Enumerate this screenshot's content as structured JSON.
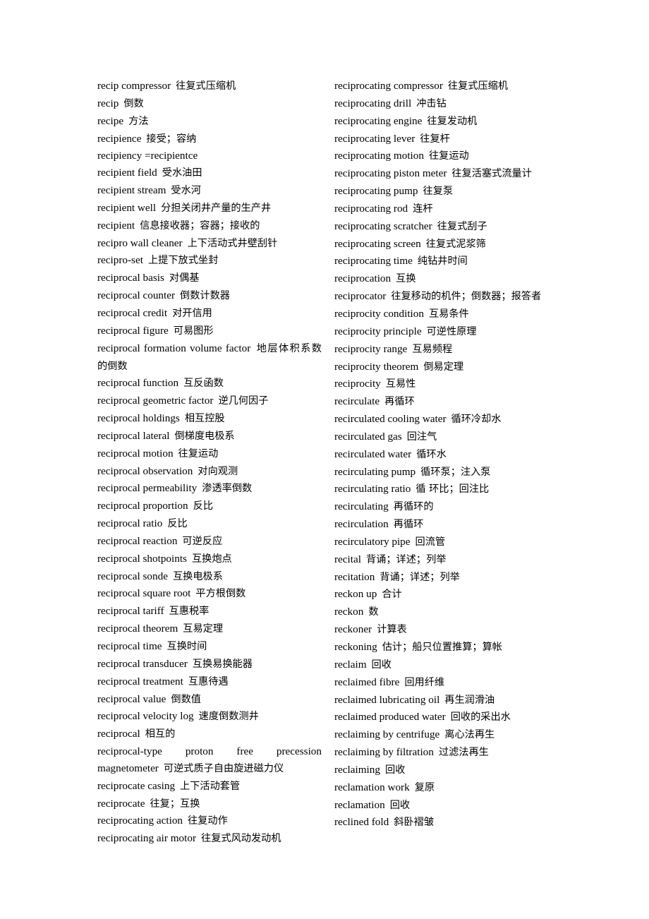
{
  "document": {
    "type": "bilingual-glossary-page",
    "language_pair": "English-Chinese",
    "background_color": "#ffffff",
    "text_color": "#000000"
  },
  "columns": [
    {
      "id": "left-column",
      "entries": [
        {
          "en": "recip compressor",
          "zh": "往复式压缩机"
        },
        {
          "en": "recip",
          "zh": "倒数"
        },
        {
          "en": "recipe",
          "zh": "方法"
        },
        {
          "en": "recipience",
          "zh": "接受；容纳"
        },
        {
          "en": "recipiency =recipientce",
          "zh": ""
        },
        {
          "en": "recipient field",
          "zh": "受水油田"
        },
        {
          "en": "recipient stream",
          "zh": "受水河"
        },
        {
          "en": "recipient well",
          "zh": "分担关闭井产量的生产井"
        },
        {
          "en": "recipient",
          "zh": "信息接收器；容器；接收的"
        },
        {
          "en": "recipro wall cleaner",
          "zh": "上下活动式井壁刮针"
        },
        {
          "en": "recipro-set",
          "zh": "上提下放式坐封"
        },
        {
          "en": "reciprocal basis",
          "zh": "对偶基"
        },
        {
          "en": "reciprocal counter",
          "zh": "倒数计数器"
        },
        {
          "en": "reciprocal credit",
          "zh": "对开信用"
        },
        {
          "en": "reciprocal figure",
          "zh": "可易图形"
        },
        {
          "en": "reciprocal formation volume factor",
          "zh": "地层体积系数的倒数",
          "wrap": true
        },
        {
          "en": "reciprocal function",
          "zh": "互反函数"
        },
        {
          "en": "reciprocal geometric factor",
          "zh": "逆几何因子"
        },
        {
          "en": "reciprocal holdings",
          "zh": "相互控股"
        },
        {
          "en": "reciprocal lateral",
          "zh": "倒梯度电极系"
        },
        {
          "en": "reciprocal motion",
          "zh": "往复运动"
        },
        {
          "en": "reciprocal observation",
          "zh": "对向观测"
        },
        {
          "en": "reciprocal permeability",
          "zh": "渗透率倒数"
        },
        {
          "en": "reciprocal proportion",
          "zh": "反比"
        },
        {
          "en": "reciprocal ratio",
          "zh": "反比"
        },
        {
          "en": "reciprocal reaction",
          "zh": "可逆反应"
        },
        {
          "en": "reciprocal shotpoints",
          "zh": "互换炮点"
        },
        {
          "en": "reciprocal sonde",
          "zh": "互换电极系"
        },
        {
          "en": "reciprocal square root",
          "zh": "平方根倒数"
        },
        {
          "en": "reciprocal tariff",
          "zh": "互惠税率"
        },
        {
          "en": "reciprocal theorem",
          "zh": "互易定理"
        },
        {
          "en": "reciprocal time",
          "zh": "互换时间"
        },
        {
          "en": "reciprocal transducer",
          "zh": "互换易换能器"
        },
        {
          "en": "reciprocal treatment",
          "zh": "互惠待遇"
        },
        {
          "en": "reciprocal value",
          "zh": "倒数值"
        },
        {
          "en": "reciprocal velocity log",
          "zh": "速度倒数测井"
        },
        {
          "en": "reciprocal",
          "zh": "相互的"
        },
        {
          "en": "reciprocal-type proton free precession magnetometer",
          "zh": "可逆式质子自由旋进磁力仪",
          "wrap": true,
          "spread": true
        },
        {
          "en": "reciprocate casing",
          "zh": "上下活动套管"
        },
        {
          "en": "reciprocate",
          "zh": "往复；互换"
        },
        {
          "en": "reciprocating action",
          "zh": "往复动作"
        },
        {
          "en": "reciprocating air motor",
          "zh": "往复式风动发动机"
        }
      ]
    },
    {
      "id": "right-column",
      "entries": [
        {
          "en": "reciprocating compressor",
          "zh": "往复式压缩机"
        },
        {
          "en": "reciprocating drill",
          "zh": "冲击钻"
        },
        {
          "en": "reciprocating engine",
          "zh": "往复发动机"
        },
        {
          "en": "reciprocating lever",
          "zh": "往复杆"
        },
        {
          "en": "reciprocating motion",
          "zh": "往复运动"
        },
        {
          "en": "reciprocating piston meter",
          "zh": "往复活塞式流量计"
        },
        {
          "en": "reciprocating pump",
          "zh": "往复泵"
        },
        {
          "en": "reciprocating rod",
          "zh": "连杆"
        },
        {
          "en": "reciprocating scratcher",
          "zh": "往复式刮子"
        },
        {
          "en": "reciprocating screen",
          "zh": "往复式泥浆筛"
        },
        {
          "en": "reciprocating time",
          "zh": "纯钻井时间"
        },
        {
          "en": "reciprocation",
          "zh": "互换"
        },
        {
          "en": "reciprocator",
          "zh": "往复移动的机件；倒数器；报答者",
          "wrap": true
        },
        {
          "en": "reciprocity condition",
          "zh": "互易条件"
        },
        {
          "en": "reciprocity principle",
          "zh": "可逆性原理"
        },
        {
          "en": "reciprocity range",
          "zh": "互易频程"
        },
        {
          "en": "reciprocity theorem",
          "zh": "倒易定理"
        },
        {
          "en": "reciprocity",
          "zh": "互易性"
        },
        {
          "en": "recirculate",
          "zh": "再循环"
        },
        {
          "en": "recirculated cooling water",
          "zh": "循环冷却水"
        },
        {
          "en": "recirculated gas",
          "zh": "回注气"
        },
        {
          "en": "recirculated water",
          "zh": "循环水"
        },
        {
          "en": "recirculating pump",
          "zh": "循环泵；注入泵"
        },
        {
          "en": "recirculating ratio",
          "zh": "循 环比；回注比"
        },
        {
          "en": "recirculating",
          "zh": "再循环的"
        },
        {
          "en": "recirculation",
          "zh": "再循环"
        },
        {
          "en": "recirculatory pipe",
          "zh": "回流管"
        },
        {
          "en": "recital",
          "zh": "背诵；详述；列举"
        },
        {
          "en": "recitation",
          "zh": "背诵；详述；列举"
        },
        {
          "en": "reckon up",
          "zh": "合计"
        },
        {
          "en": "reckon",
          "zh": "数"
        },
        {
          "en": "reckoner",
          "zh": "计算表"
        },
        {
          "en": "reckoning",
          "zh": "估计；船只位置推算；算帐"
        },
        {
          "en": "reclaim",
          "zh": "回收"
        },
        {
          "en": "reclaimed fibre",
          "zh": "回用纤维"
        },
        {
          "en": "reclaimed lubricating oil",
          "zh": "再生润滑油"
        },
        {
          "en": "reclaimed produced water",
          "zh": "回收的采出水"
        },
        {
          "en": "reclaiming by centrifuge",
          "zh": "离心法再生"
        },
        {
          "en": "reclaiming by filtration",
          "zh": "过滤法再生"
        },
        {
          "en": "reclaiming",
          "zh": "回收"
        },
        {
          "en": "reclamation work",
          "zh": "复原"
        },
        {
          "en": "reclamation",
          "zh": "回收"
        },
        {
          "en": "reclined fold",
          "zh": "斜卧褶皱"
        }
      ]
    }
  ]
}
